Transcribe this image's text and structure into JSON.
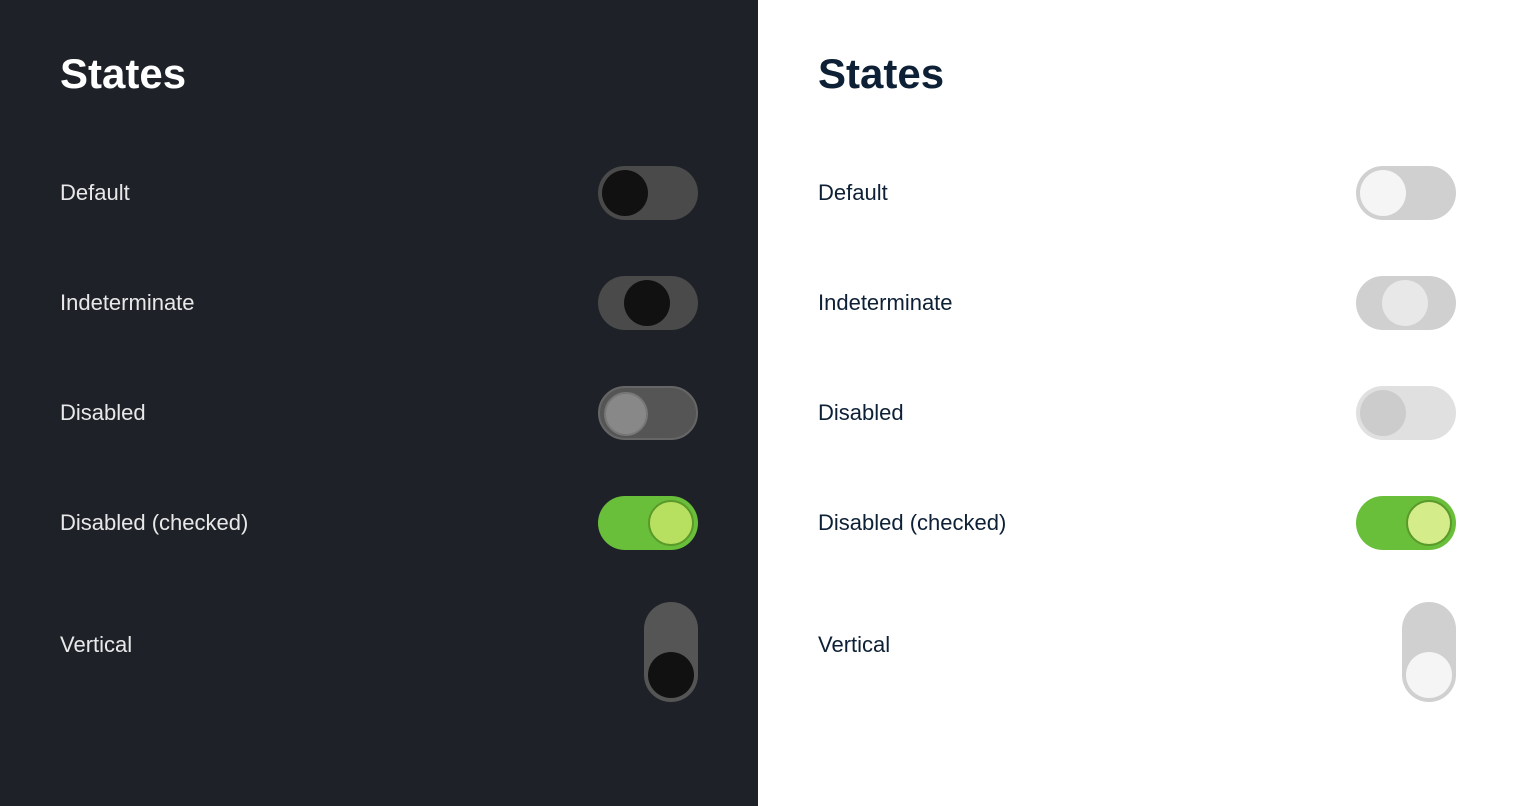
{
  "dark_panel": {
    "title": "States",
    "items": [
      {
        "label": "Default"
      },
      {
        "label": "Indeterminate"
      },
      {
        "label": "Disabled"
      },
      {
        "label": "Disabled (checked)"
      },
      {
        "label": "Vertical"
      }
    ]
  },
  "light_panel": {
    "title": "States",
    "items": [
      {
        "label": "Default"
      },
      {
        "label": "Indeterminate"
      },
      {
        "label": "Disabled"
      },
      {
        "label": "Disabled (checked)"
      },
      {
        "label": "Vertical"
      }
    ]
  }
}
